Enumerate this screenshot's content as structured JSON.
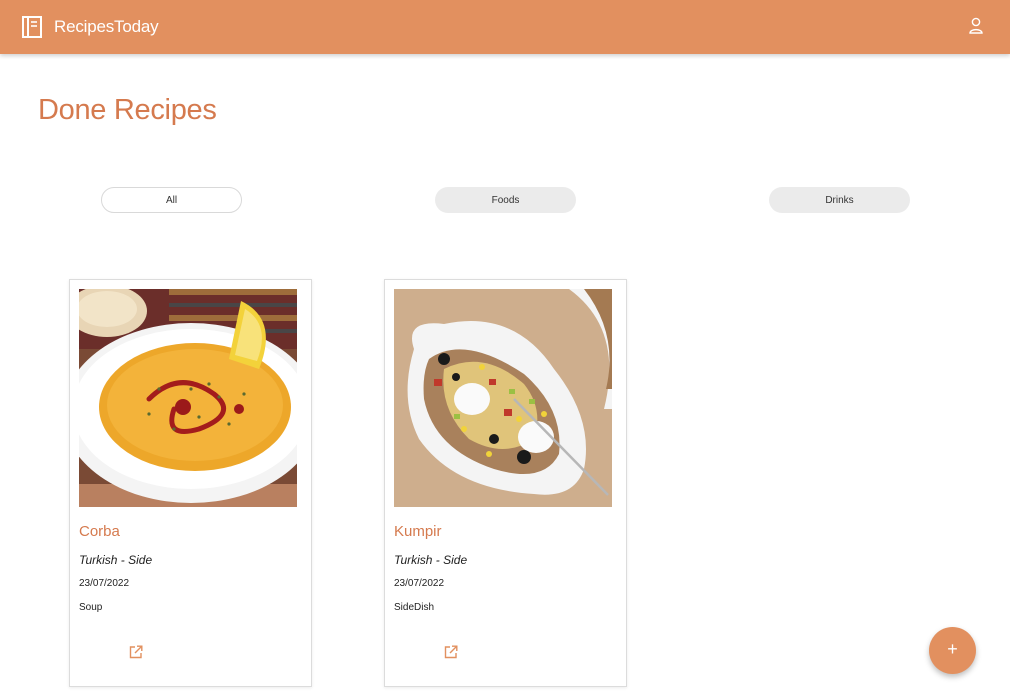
{
  "header": {
    "brand_name": "RecipesToday",
    "brand_icon": "book-icon",
    "profile_icon": "user-icon",
    "bar_color": "#e2905f"
  },
  "page": {
    "title": "Done Recipes"
  },
  "filters": [
    {
      "label": "All",
      "selected": true
    },
    {
      "label": "Foods",
      "selected": false
    },
    {
      "label": "Drinks",
      "selected": false
    }
  ],
  "recipes": [
    {
      "name": "Corba",
      "category": "Turkish - Side",
      "done_date": "23/07/2022",
      "tag": "Soup",
      "image": "soup-bowl-photo",
      "share_icon": "share-icon"
    },
    {
      "name": "Kumpir",
      "category": "Turkish - Side",
      "done_date": "23/07/2022",
      "tag": "SideDish",
      "image": "baked-potato-photo",
      "share_icon": "share-icon"
    }
  ],
  "fab": {
    "label": "+",
    "icon": "plus-icon"
  },
  "colors": {
    "accent": "#e2905f",
    "title": "#d57a4e"
  }
}
